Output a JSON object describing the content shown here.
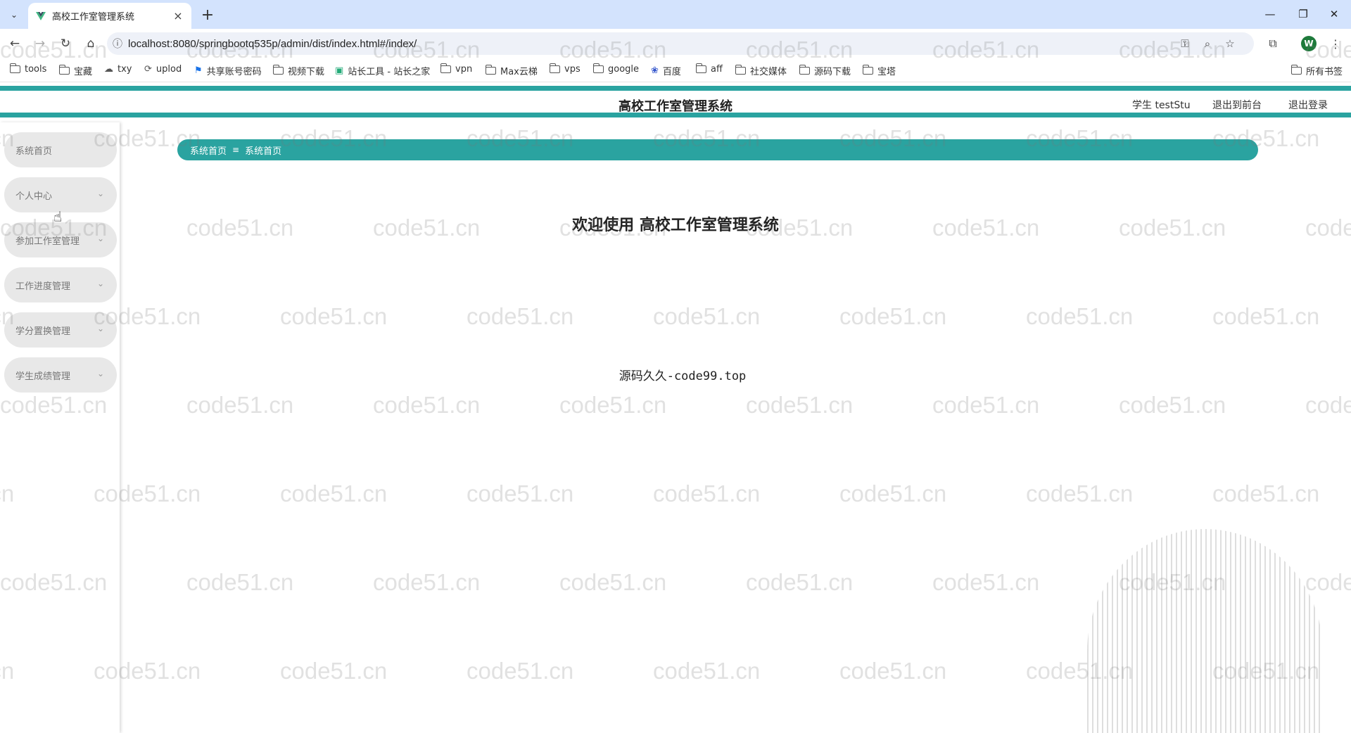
{
  "browser": {
    "tab_title": "高校工作室管理系统",
    "url": "localhost:8080/springbootq535p/admin/dist/index.html#/index/",
    "profile_initial": "W",
    "bookmarks": [
      "tools",
      "宝藏",
      "txy",
      "uplod",
      "共享账号密码",
      "视频下载",
      "站长工具 - 站长之家",
      "vpn",
      "Max云梯",
      "vps",
      "google",
      "百度",
      "aff",
      "社交媒体",
      "源码下载",
      "宝塔"
    ],
    "all_bookmarks": "所有书签"
  },
  "header": {
    "title": "高校工作室管理系统",
    "user": "学生 testStu",
    "back_to_front": "退出到前台",
    "logout": "退出登录"
  },
  "sidebar": {
    "items": [
      {
        "label": "系统首页",
        "has_chevron": false
      },
      {
        "label": "个人中心",
        "has_chevron": true
      },
      {
        "label": "参加工作室管理",
        "has_chevron": true
      },
      {
        "label": "工作进度管理",
        "has_chevron": true
      },
      {
        "label": "学分置换管理",
        "has_chevron": true
      },
      {
        "label": "学生成绩管理",
        "has_chevron": true
      }
    ]
  },
  "breadcrumb": {
    "home": "系统首页",
    "separator": "≡",
    "current": "系统首页"
  },
  "main": {
    "welcome": "欢迎使用 高校工作室管理系统",
    "source_text": "源码久久-code99.top"
  },
  "watermark": {
    "text": "code51.cn"
  },
  "colors": {
    "accent": "#2aa3a0",
    "sidebar_item_bg": "#e8e8e8"
  }
}
